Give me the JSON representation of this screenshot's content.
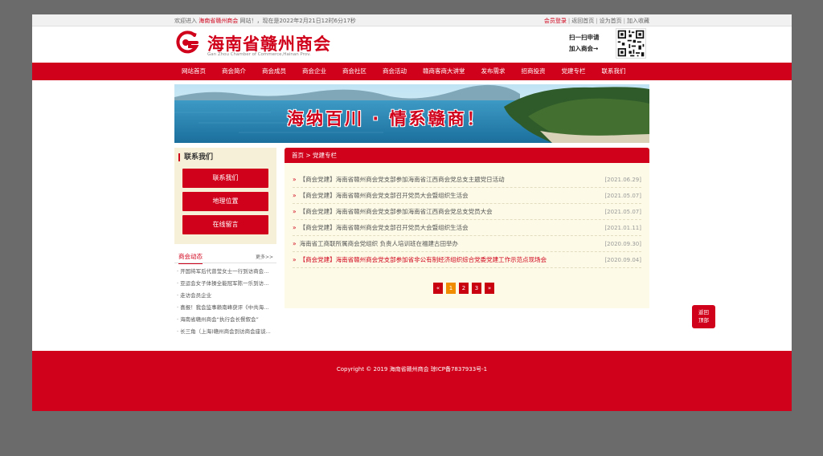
{
  "topbar": {
    "welcome_prefix": "欢迎进入",
    "site_name": "海南省赣州商会",
    "welcome_suffix": "网站！，现在是2022年2月21日12时6分17秒",
    "links": [
      "会员登录",
      "返回首页",
      "设为首页",
      "加入收藏"
    ]
  },
  "header": {
    "logo_cn": "海南省赣州商会",
    "logo_en": "Gan Zhou Chamber of Commerce,Hainan Prov.",
    "join_line1": "扫一扫申请",
    "join_line2": "加入商会→"
  },
  "nav": {
    "items": [
      "网站首页",
      "商会简介",
      "商会成员",
      "商会企业",
      "商会社区",
      "商会活动",
      "赣商客商大讲堂",
      "发布需求",
      "招商投资",
      "党建专栏",
      "联系我们"
    ]
  },
  "banner": {
    "slogan": "海纳百川 · 情系赣商！"
  },
  "sidebar": {
    "title": "联系我们",
    "buttons": [
      "联系我们",
      "地理位置",
      "在线留言"
    ],
    "news_title": "商会动态",
    "news_more": "更多>>",
    "news_items": [
      "· 开国将军后代曾莹女士一行到访商会...",
      "· 亚运会女子体操全能冠军陈一乐到访...",
      "· 走访会员企业",
      "· 喜报！我会监事赖南峰获评《中共海...",
      "· 海南省赣州商会“执行会长餐叙会”",
      "· 长三角（上海)赣州商会到访商会座谈..."
    ]
  },
  "main": {
    "breadcrumb": "首页 > 党建专栏",
    "articles": [
      {
        "title": "【商会党建】海南省赣州商会党支部参加海南省江西商会党总支主题党日活动",
        "date": "[2021.06.29]",
        "red": false
      },
      {
        "title": "【商会党建】海南省赣州商会党支部召开党员大会暨组织生活会",
        "date": "[2021.05.07]",
        "red": false
      },
      {
        "title": "【商会党建】海南省赣州商会党支部参加海南省江西商会党总支党员大会",
        "date": "[2021.05.07]",
        "red": false
      },
      {
        "title": "【商会党建】海南省赣州商会党支部召开党员大会暨组织生活会",
        "date": "[2021.01.11]",
        "red": false
      },
      {
        "title": "海南省工商联所属商会党组织 负责人培训班在福建古田举办",
        "date": "[2020.09.30]",
        "red": false
      },
      {
        "title": "【商会党建】海南省赣州商会党支部参加省非公有制经济组织综合党委党建工作示范点现场会",
        "date": "[2020.09.04]",
        "red": true
      }
    ],
    "pager": [
      "«",
      "1",
      "2",
      "3",
      "»"
    ],
    "pager_active": "1"
  },
  "backtop": {
    "line1": "返回",
    "line2": "顶部"
  },
  "footer": {
    "copyright": "Copyright © 2019 海南省赣州商会 琼ICP备7837933号-1"
  },
  "colors": {
    "brand_red": "#d0021b",
    "page_bg": "#6b6b6b",
    "main_bg": "#fdfbe7",
    "side_bg": "#f7f0d8",
    "pager_active": "#f08c00"
  }
}
